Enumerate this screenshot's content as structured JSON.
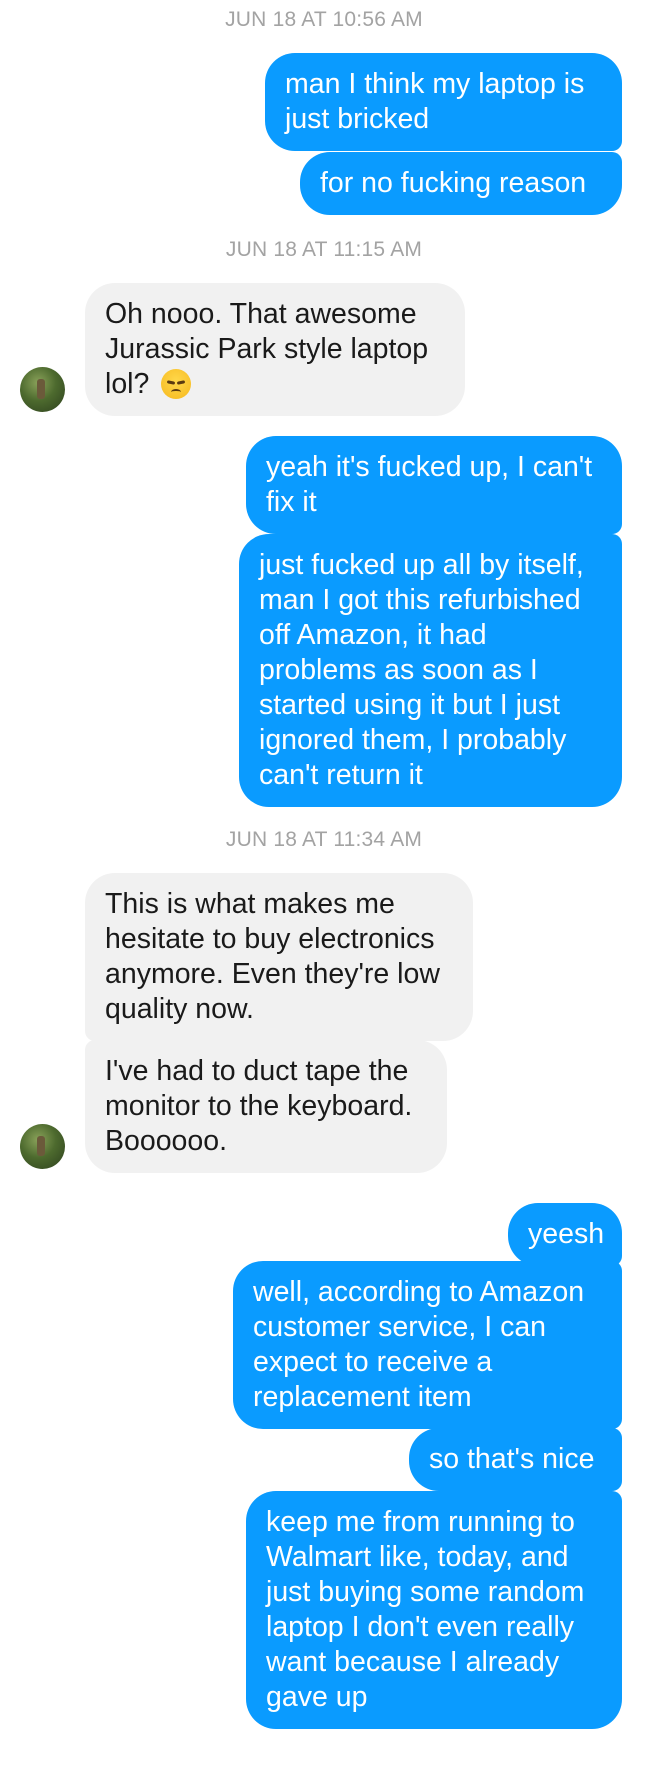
{
  "timestamps": [
    "JUN 18 AT 10:56 AM",
    "JUN 18 AT 11:15 AM",
    "JUN 18 AT 11:34 AM"
  ],
  "messages": [
    {
      "from": "me",
      "lines": [
        "man I think my laptop is",
        "just bricked"
      ]
    },
    {
      "from": "me",
      "lines": [
        "for no fucking reason"
      ]
    },
    {
      "from": "them",
      "lines": [
        "Oh nooo. That awesome",
        "Jurassic Park style laptop",
        "lol?"
      ],
      "emoji": "disappointed-face"
    },
    {
      "from": "me",
      "lines": [
        "yeah it's fucked up, I can't",
        "fix it"
      ]
    },
    {
      "from": "me",
      "lines": [
        "just fucked up all by itself,",
        "man I got this refurbished",
        "off Amazon, it had",
        "problems as soon as I",
        "started using it but I just",
        "ignored them, I probably",
        "can't return it"
      ]
    },
    {
      "from": "them",
      "lines": [
        "This is what makes me",
        "hesitate to buy electronics",
        "anymore. Even they're low",
        "quality now."
      ]
    },
    {
      "from": "them",
      "lines": [
        "I've had to duct tape the",
        "monitor to the keyboard.",
        "Boooooo."
      ]
    },
    {
      "from": "me",
      "lines": [
        "yeesh"
      ]
    },
    {
      "from": "me",
      "lines": [
        "well, according to Amazon",
        "customer service, I can",
        "expect to receive a",
        "replacement item"
      ]
    },
    {
      "from": "me",
      "lines": [
        "so that's nice"
      ]
    },
    {
      "from": "me",
      "lines": [
        "keep me from running to",
        "Walmart like, today, and",
        "just buying some random",
        "laptop I don't even really",
        "want because I already",
        "gave up"
      ]
    }
  ],
  "colors": {
    "sent": "#0a9bff",
    "received": "#f1f1f1",
    "timestamp": "#a3a3a3"
  }
}
